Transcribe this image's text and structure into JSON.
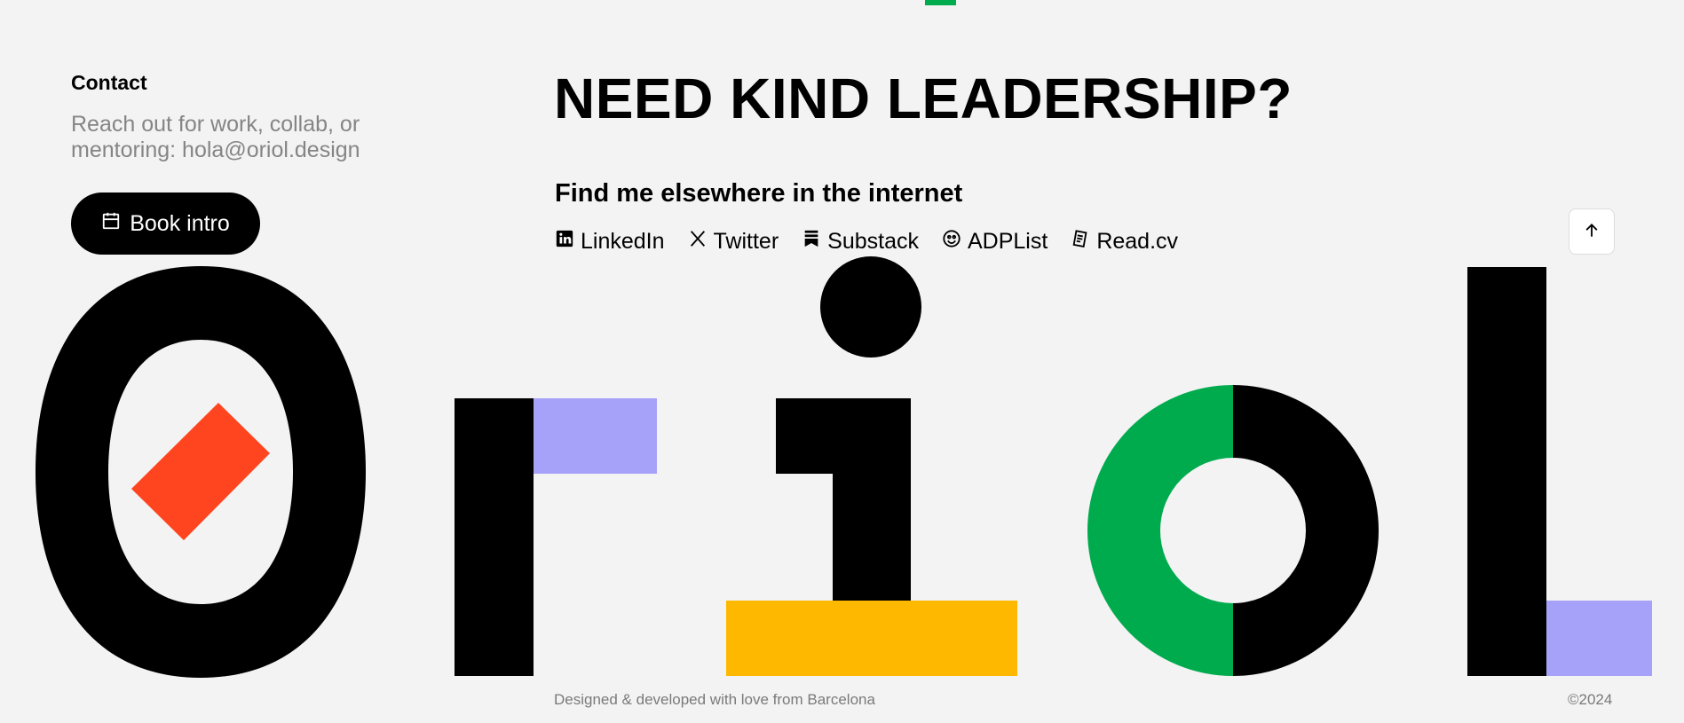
{
  "colors": {
    "background": "#f3f3f3",
    "accent_green": "#00ab4e",
    "red": "#ff4520",
    "purple": "#a7a2f9",
    "yellow": "#ffb800",
    "black": "#000000"
  },
  "contact": {
    "heading": "Contact",
    "text": "Reach out for work, collab, or mentoring: hola@oriol.design",
    "book_button": {
      "label": "Book intro",
      "icon": "calendar-icon"
    }
  },
  "main": {
    "headline": "NEED KIND LEADERSHIP?",
    "subheading": "Find me elsewhere in the internet",
    "social_links": [
      {
        "label": "LinkedIn",
        "icon": "linkedin-icon"
      },
      {
        "label": "Twitter",
        "icon": "x-twitter-icon"
      },
      {
        "label": "Substack",
        "icon": "substack-icon"
      },
      {
        "label": "ADPList",
        "icon": "smiley-icon"
      },
      {
        "label": "Read.cv",
        "icon": "document-icon"
      }
    ]
  },
  "scroll_top": {
    "icon": "arrow-up-icon"
  },
  "logo": {
    "word": "oriol"
  },
  "footer": {
    "credit": "Designed & developed with love from Barcelona",
    "copyright": "©2024"
  }
}
